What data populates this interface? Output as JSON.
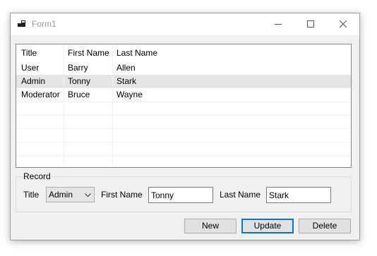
{
  "window": {
    "title": "Form1"
  },
  "grid": {
    "columns": [
      "Title",
      "First Name",
      "Last Name"
    ],
    "rows": [
      [
        "User",
        "Barry",
        "Allen"
      ],
      [
        "Admin",
        "Tonny",
        "Stark"
      ],
      [
        "Moderator",
        "Bruce",
        "Wayne"
      ]
    ],
    "selected_row": 1
  },
  "record": {
    "group_label": "Record",
    "title_label": "Title",
    "title_value": "Admin",
    "first_name_label": "First Name",
    "first_name_value": "Tonny",
    "last_name_label": "Last Name",
    "last_name_value": "Stark"
  },
  "buttons": {
    "new_label": "New",
    "update_label": "Update",
    "delete_label": "Delete"
  },
  "icons": {
    "app": "app-icon",
    "minimize": "minimize-icon",
    "maximize": "maximize-icon",
    "close": "close-icon",
    "dropdown": "chevron-down-icon"
  },
  "colors": {
    "selection": "#e5e5e5",
    "default_button_border": "#0078d7",
    "app_icon": "#1f1f1f"
  }
}
